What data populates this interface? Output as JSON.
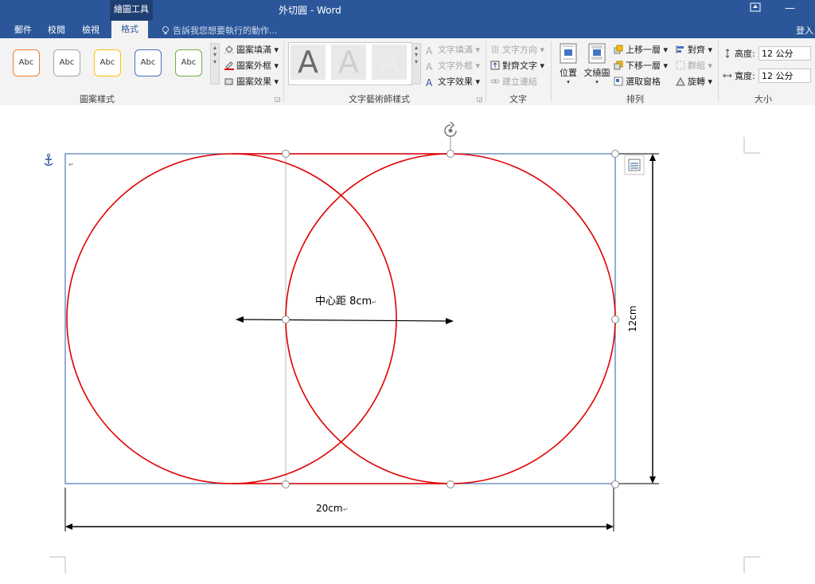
{
  "titlebar": {
    "contextual_tab": "繪圖工具",
    "document_title": "外切圓 - Word",
    "restore_icon": "ribbon-display-icon",
    "minimize_symbol": "—"
  },
  "tabs": {
    "items": [
      "郵件",
      "校閱",
      "檢視",
      "格式"
    ],
    "active": "格式",
    "tell_me": "告訴我您想要執行的動作...",
    "signin": "登入"
  },
  "ribbon": {
    "shape_styles": {
      "label": "圖案樣式",
      "samples": [
        "Abc",
        "Abc",
        "Abc",
        "Abc",
        "Abc"
      ],
      "sample_colors": [
        "#ed7d31",
        "#a5a5a5",
        "#ffc000",
        "#4472c4",
        "#70ad47"
      ],
      "fill": "圖案填滿",
      "outline": "圖案外框",
      "effects": "圖案效果"
    },
    "wordart": {
      "label": "文字藝術師樣式",
      "letter": "A",
      "text_fill": "文字填滿",
      "text_outline": "文字外框",
      "text_effects": "文字效果"
    },
    "text": {
      "label": "文字",
      "direction": "文字方向",
      "align": "對齊文字",
      "link": "建立連結"
    },
    "arrange": {
      "label": "排列",
      "position": "位置",
      "wrap": "文繞圖",
      "bring_forward": "上移一層",
      "send_backward": "下移一層",
      "selection_pane": "選取窗格",
      "align": "對齊",
      "group": "群組",
      "rotate": "旋轉"
    },
    "size": {
      "label": "大小",
      "height_label": "高度:",
      "height_value": "12 公分",
      "width_label": "寬度:",
      "width_value": "12 公分"
    }
  },
  "document": {
    "center_distance_label": "中心距 8cm",
    "height_label": "12cm",
    "width_label": "20cm",
    "circle_color": "#e00000",
    "frame_color": "#4a78b5"
  }
}
